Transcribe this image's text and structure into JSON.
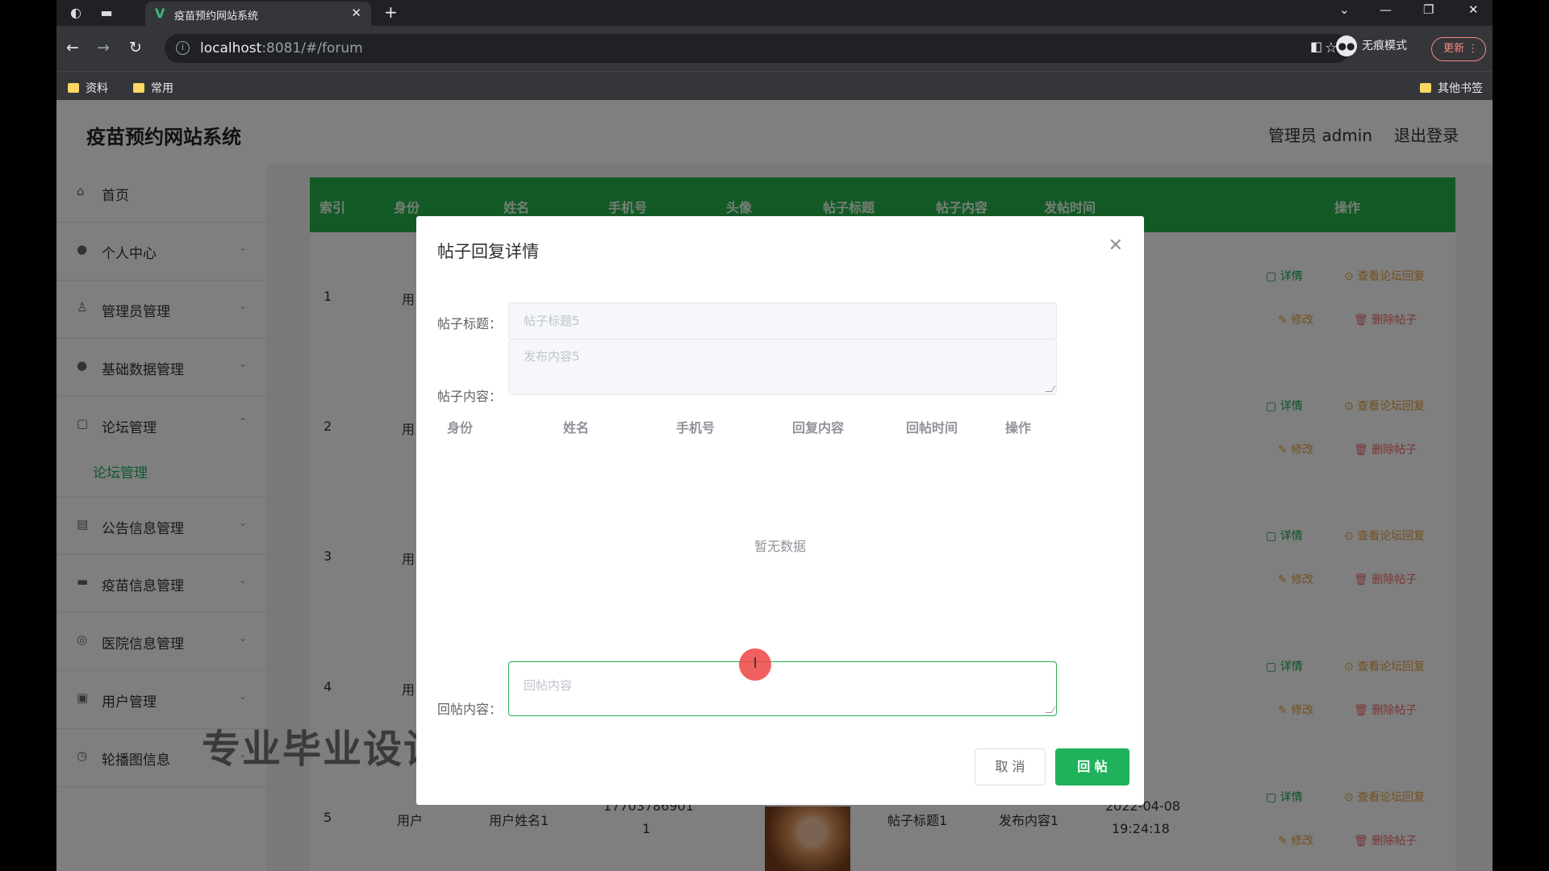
{
  "browser": {
    "tab_title": "疫苗预约网站系统",
    "url_host": "localhost",
    "url_rest": ":8081/#/forum",
    "incognito_label": "无痕模式",
    "update_label": "更新",
    "bookmarks": [
      "资料",
      "常用"
    ],
    "other_bookmarks": "其他书签"
  },
  "header": {
    "system_title": "疫苗预约网站系统",
    "user_label": "管理员 admin",
    "logout_label": "退出登录"
  },
  "sidebar": {
    "items": [
      {
        "label": "首页",
        "icon": "home-icon"
      },
      {
        "label": "个人中心",
        "icon": "user-icon"
      },
      {
        "label": "管理员管理",
        "icon": "admin-icon"
      },
      {
        "label": "基础数据管理",
        "icon": "user-icon"
      },
      {
        "label": "论坛管理",
        "icon": "forum-icon"
      },
      {
        "label": "论坛管理",
        "icon": ""
      },
      {
        "label": "公告信息管理",
        "icon": "notice-icon"
      },
      {
        "label": "疫苗信息管理",
        "icon": "vaccine-icon"
      },
      {
        "label": "医院信息管理",
        "icon": "hospital-icon"
      },
      {
        "label": "用户管理",
        "icon": "user-icon"
      },
      {
        "label": "轮播图信息",
        "icon": "carousel-icon"
      }
    ]
  },
  "table": {
    "headers": [
      "索引",
      "身份",
      "姓名",
      "手机号",
      "头像",
      "帖子标题",
      "帖子内容",
      "发帖时间",
      "操作"
    ],
    "rows": [
      {
        "index": "1",
        "role": "用"
      },
      {
        "index": "2",
        "role": "用"
      },
      {
        "index": "3",
        "role": "用"
      },
      {
        "index": "4",
        "role": "用"
      },
      {
        "index": "5",
        "role": "用户",
        "name": "用户姓名1",
        "phone_a": "17703786901",
        "phone_b": "1",
        "title": "帖子标题1",
        "content": "发布内容1",
        "date": "2022-04-08",
        "time": "19:24:18"
      }
    ],
    "actions": {
      "detail": "详情",
      "view_reply": "查看论坛回复",
      "edit": "修改",
      "delete": "删除帖子"
    }
  },
  "dialog": {
    "title": "帖子回复详情",
    "post_title_label": "帖子标题：",
    "post_title_value": "帖子标题5",
    "post_content_label": "帖子内容：",
    "post_content_value": "发布内容5",
    "reply_headers": [
      "身份",
      "姓名",
      "手机号",
      "回复内容",
      "回帖时间",
      "操作"
    ],
    "empty_text": "暂无数据",
    "reply_label": "回帖内容：",
    "reply_placeholder": "回帖内容",
    "cancel_label": "取 消",
    "submit_label": "回 帖"
  },
  "watermark": "专业毕业设计"
}
